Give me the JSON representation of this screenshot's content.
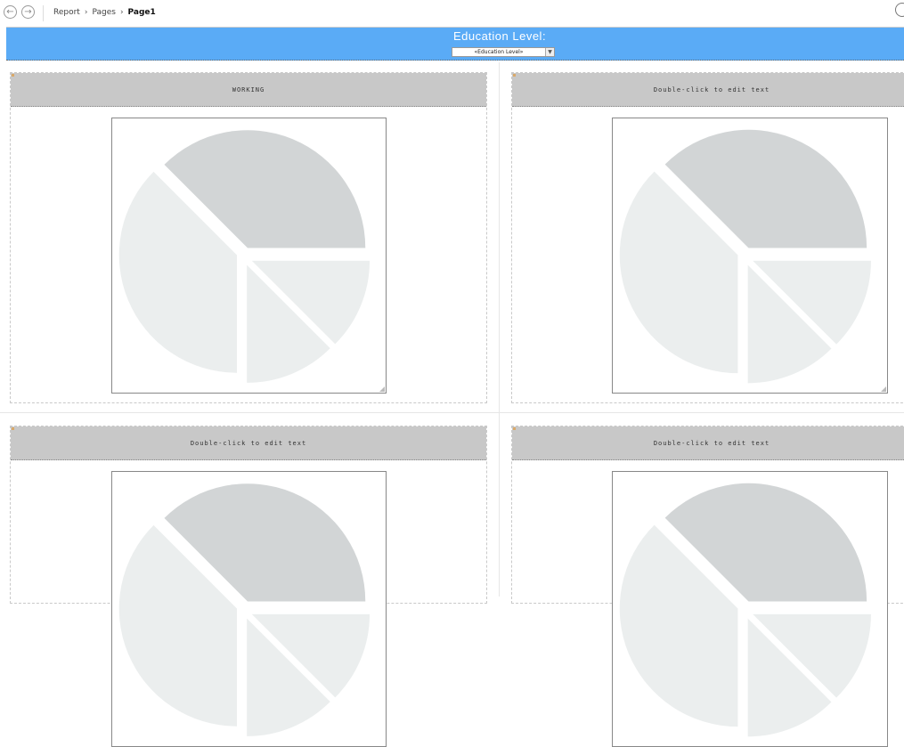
{
  "breadcrumb": {
    "items": [
      "Report",
      "Pages",
      "Page1"
    ],
    "separator": "›"
  },
  "filter": {
    "title": "Education Level:",
    "selected": "«Education Level»"
  },
  "panels": [
    {
      "header": "WORKING"
    },
    {
      "header": "Double-click to edit text"
    },
    {
      "header": "Double-click to edit text"
    },
    {
      "header": "Double-click to edit text"
    }
  ],
  "colors": {
    "accent": "#5aabf6",
    "header_bg": "#c8c8c8",
    "pie_dark": "#d2d5d6",
    "pie_light": "#ebeeee"
  },
  "icons": {
    "back": "back-arrow-icon",
    "forward": "forward-arrow-icon",
    "chevron": "chevron-right-icon",
    "dropdown": "chevron-down-icon"
  }
}
